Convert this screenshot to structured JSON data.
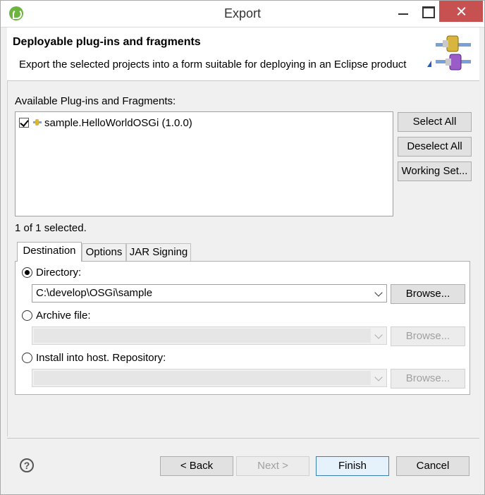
{
  "window": {
    "title": "Export"
  },
  "header": {
    "title": "Deployable plug-ins and fragments",
    "description": "Export the selected projects into a form suitable for deploying in an Eclipse product"
  },
  "plugins": {
    "label": "Available Plug-ins and Fragments:",
    "items": [
      {
        "label": "sample.HelloWorldOSGi (1.0.0)",
        "checked": true
      }
    ],
    "selection_status": "1 of 1 selected."
  },
  "side_buttons": {
    "select_all": "Select All",
    "deselect_all": "Deselect All",
    "working_set": "Working Set..."
  },
  "tabs": [
    {
      "label": "Destination",
      "active": true
    },
    {
      "label": "Options",
      "active": false
    },
    {
      "label": "JAR Signing",
      "active": false
    }
  ],
  "destination": {
    "directory": {
      "label": "Directory:",
      "selected": true,
      "value": "C:\\develop\\OSGi\\sample",
      "browse": "Browse..."
    },
    "archive": {
      "label": "Archive file:",
      "selected": false,
      "value": "",
      "browse": "Browse..."
    },
    "install": {
      "label": "Install into host. Repository:",
      "selected": false,
      "value": "",
      "browse": "Browse..."
    }
  },
  "footer": {
    "help": "?",
    "back": "< Back",
    "next": "Next >",
    "finish": "Finish",
    "cancel": "Cancel"
  },
  "colors": {
    "close_button": "#c75050",
    "default_button_border": "#3c7fb1"
  }
}
